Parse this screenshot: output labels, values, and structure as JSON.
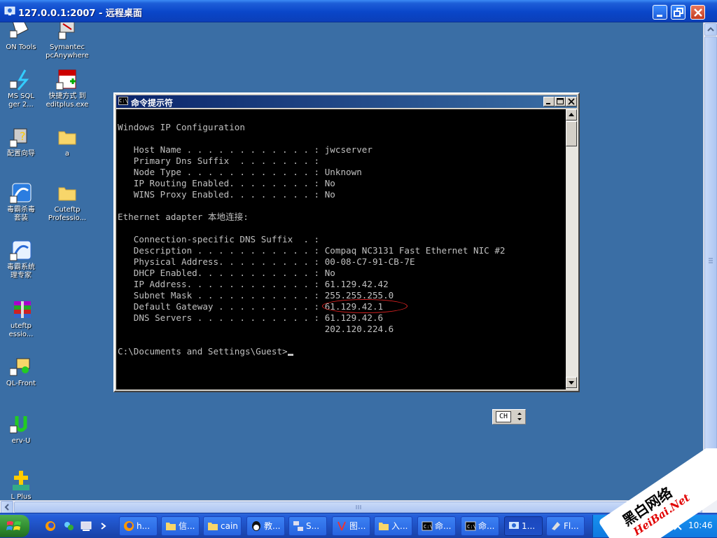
{
  "outer_window": {
    "title": "127.0.0.1:2007 - 远程桌面"
  },
  "desktop_icons": [
    {
      "label": "ON Tools",
      "icon": "tools-icon"
    },
    {
      "label": "Symantec\npcAnywhere",
      "icon": "pcanywhere-icon"
    },
    {
      "label": "MS SQL\nger 2...",
      "icon": "sql-server-icon"
    },
    {
      "label": "快捷方式 到\neditplus.exe",
      "icon": "editplus-icon"
    },
    {
      "label": "配置向导",
      "icon": "wizard-icon"
    },
    {
      "label": "a",
      "icon": "folder-icon"
    },
    {
      "label": "毒霸杀毒\n套装",
      "icon": "antivirus-icon"
    },
    {
      "label": "Cuteftp\nProfessio...",
      "icon": "folder-icon"
    },
    {
      "label": "毒霸系统\n理专家",
      "icon": "system-expert-icon"
    },
    {
      "label": "uteftp\nessio...",
      "icon": "winrar-icon"
    },
    {
      "label": "QL-Front",
      "icon": "sqlfront-icon"
    },
    {
      "label": "erv-U",
      "icon": "servu-icon"
    },
    {
      "label": "L Plus",
      "icon": "plus-icon"
    }
  ],
  "cmd_window": {
    "title": "命令提示符",
    "icon_text": "C:\\",
    "lines": [
      "",
      "Windows IP Configuration",
      "",
      "   Host Name . . . . . . . . . . . . : jwcserver",
      "   Primary Dns Suffix  . . . . . . . :",
      "   Node Type . . . . . . . . . . . . : Unknown",
      "   IP Routing Enabled. . . . . . . . : No",
      "   WINS Proxy Enabled. . . . . . . . : No",
      "",
      "Ethernet adapter 本地连接:",
      "",
      "   Connection-specific DNS Suffix  . :",
      "   Description . . . . . . . . . . . : Compaq NC3131 Fast Ethernet NIC #2",
      "   Physical Address. . . . . . . . . : 00-08-C7-91-CB-7E",
      "   DHCP Enabled. . . . . . . . . . . : No",
      "   IP Address. . . . . . . . . . . . : 61.129.42.42",
      "   Subnet Mask . . . . . . . . . . . : 255.255.255.0",
      "   Default Gateway . . . . . . . . . : 61.129.42.1",
      "   DNS Servers . . . . . . . . . . . : 61.129.42.6",
      "                                       202.120.224.6",
      "",
      "C:\\Documents and Settings\\Guest>"
    ]
  },
  "language_bar": {
    "label": "CH"
  },
  "taskbar": {
    "buttons": [
      {
        "label": "h...",
        "icon": "browser-icon"
      },
      {
        "label": "信...",
        "icon": "folder-icon"
      },
      {
        "label": "cain",
        "icon": "folder-icon"
      },
      {
        "label": "教...",
        "icon": "qq-icon"
      },
      {
        "label": "S...",
        "icon": "network-icon"
      },
      {
        "label": "图...",
        "icon": "tools-icon"
      },
      {
        "label": "入...",
        "icon": "folder-icon"
      },
      {
        "label": "命...",
        "icon": "cmd-icon"
      },
      {
        "label": "命...",
        "icon": "cmd-icon"
      },
      {
        "label": "1...",
        "icon": "remote-desktop-icon"
      },
      {
        "label": "Fl...",
        "icon": "fl-icon"
      }
    ],
    "clock": "10:46"
  },
  "watermark": {
    "main": "黑白网络",
    "sub": "HeiBai.Net"
  },
  "colors": {
    "desktop": "#3a6ea5",
    "console_text": "#c0c0c0",
    "gateway_circle": "#dd2222"
  }
}
